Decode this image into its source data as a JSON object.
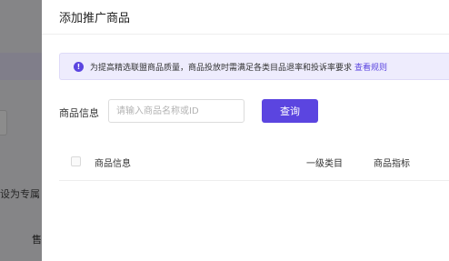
{
  "background": {
    "text_1": "设为专属",
    "text_2": "售"
  },
  "drawer": {
    "title": "添加推广商品"
  },
  "notice": {
    "icon": "!",
    "text": "为提高精选联盟商品质量，商品投放时需满足各类目品退率和投诉率要求",
    "link": "查看规则"
  },
  "filter": {
    "label": "商品信息",
    "placeholder": "请输入商品名称或ID",
    "value": "",
    "button": "查询"
  },
  "table": {
    "columns": [
      "商品信息",
      "一级类目",
      "商品指标"
    ]
  },
  "colors": {
    "accent": "#5b45e0",
    "notice_bg": "#eeecfd"
  }
}
